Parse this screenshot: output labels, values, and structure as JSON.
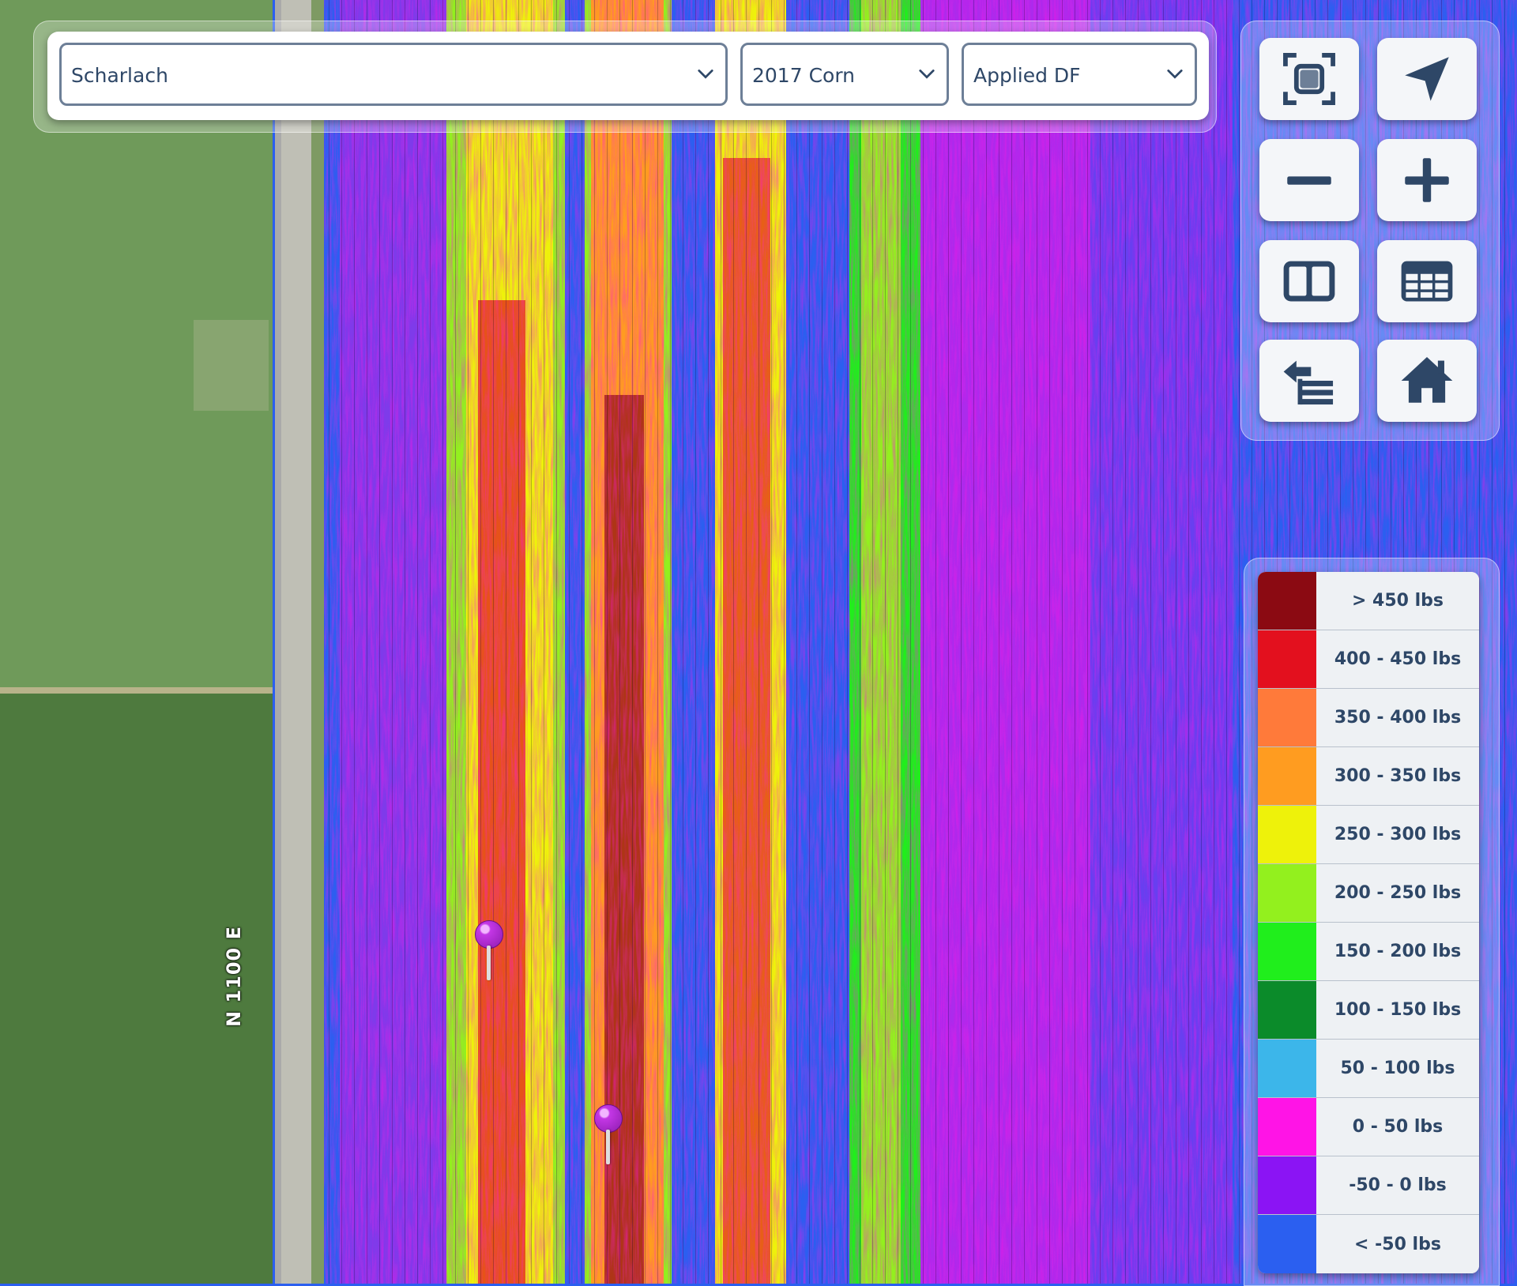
{
  "selectors": {
    "farm": "Scharlach",
    "season": "2017 Corn",
    "layer": "Applied DF"
  },
  "map": {
    "road_label": "N 1100 E"
  },
  "tools": {
    "fit_icon": "fit-extent-icon",
    "locate_icon": "navigation-arrow-icon",
    "zoom_out_icon": "minus-icon",
    "zoom_in_icon": "plus-icon",
    "split_icon": "split-view-icon",
    "table_icon": "table-icon",
    "layers_icon": "switch-layer-icon",
    "home_icon": "home-icon"
  },
  "legend": {
    "items": [
      {
        "label": "> 450 lbs",
        "color": "#8b0a12"
      },
      {
        "label": "400 - 450 lbs",
        "color": "#e3101e"
      },
      {
        "label": "350 - 400 lbs",
        "color": "#ff7a3a"
      },
      {
        "label": "300 - 350 lbs",
        "color": "#ff9c20"
      },
      {
        "label": "250 - 300 lbs",
        "color": "#eef20a"
      },
      {
        "label": "200 - 250 lbs",
        "color": "#93f01e"
      },
      {
        "label": "150 - 200 lbs",
        "color": "#20ee1c"
      },
      {
        "label": "100 - 150 lbs",
        "color": "#0b8b2a"
      },
      {
        "label": "50 - 100 lbs",
        "color": "#3cb6ea"
      },
      {
        "label": "0 - 50 lbs",
        "color": "#ff14e6"
      },
      {
        "label": "-50 - 0 lbs",
        "color": "#8b14f4"
      },
      {
        "label": "< -50 lbs",
        "color": "#2b5ff0"
      }
    ]
  }
}
